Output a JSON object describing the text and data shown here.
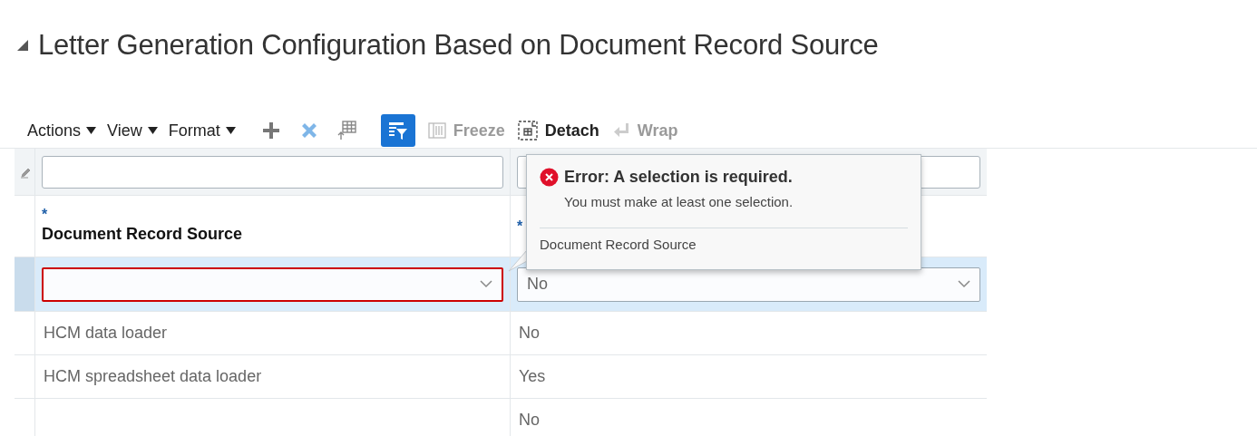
{
  "page": {
    "title": "Letter Generation Configuration Based on Document Record Source",
    "expanded": true
  },
  "toolbar": {
    "menus": [
      {
        "label": "Actions"
      },
      {
        "label": "View"
      },
      {
        "label": "Format"
      }
    ],
    "tools": [
      {
        "kind": "add",
        "disabled": false,
        "selected": false
      },
      {
        "kind": "delete",
        "disabled": false,
        "selected": false
      },
      {
        "kind": "export",
        "disabled": true,
        "selected": false
      },
      {
        "kind": "filter",
        "disabled": false,
        "selected": true
      }
    ],
    "buttons": [
      {
        "kind": "freeze",
        "label": "Freeze",
        "disabled": true
      },
      {
        "kind": "detach",
        "label": "Detach",
        "disabled": false
      },
      {
        "kind": "wrap",
        "label": "Wrap",
        "disabled": true
      }
    ]
  },
  "table": {
    "columns": [
      {
        "label": "Document Record Source",
        "required": "*"
      },
      {
        "required": "*"
      }
    ],
    "rows": [
      {
        "kind": "edit",
        "selected": true,
        "cells": [
          {
            "error": true
          },
          {
            "value": "No",
            "error": false
          }
        ]
      },
      {
        "kind": "read",
        "selected": false,
        "cells": [
          {
            "value": "HCM data loader"
          },
          {
            "value": "No"
          }
        ]
      },
      {
        "kind": "read",
        "selected": false,
        "cells": [
          {
            "value": "HCM spreadsheet data loader"
          },
          {
            "value": "Yes"
          }
        ]
      },
      {
        "kind": "read",
        "selected": false,
        "cells": [
          {},
          {
            "value": "No"
          }
        ]
      }
    ]
  },
  "error_popup": {
    "title": "Error: A selection is required.",
    "message": "You must make at least one selection.",
    "field": "Document Record Source"
  }
}
